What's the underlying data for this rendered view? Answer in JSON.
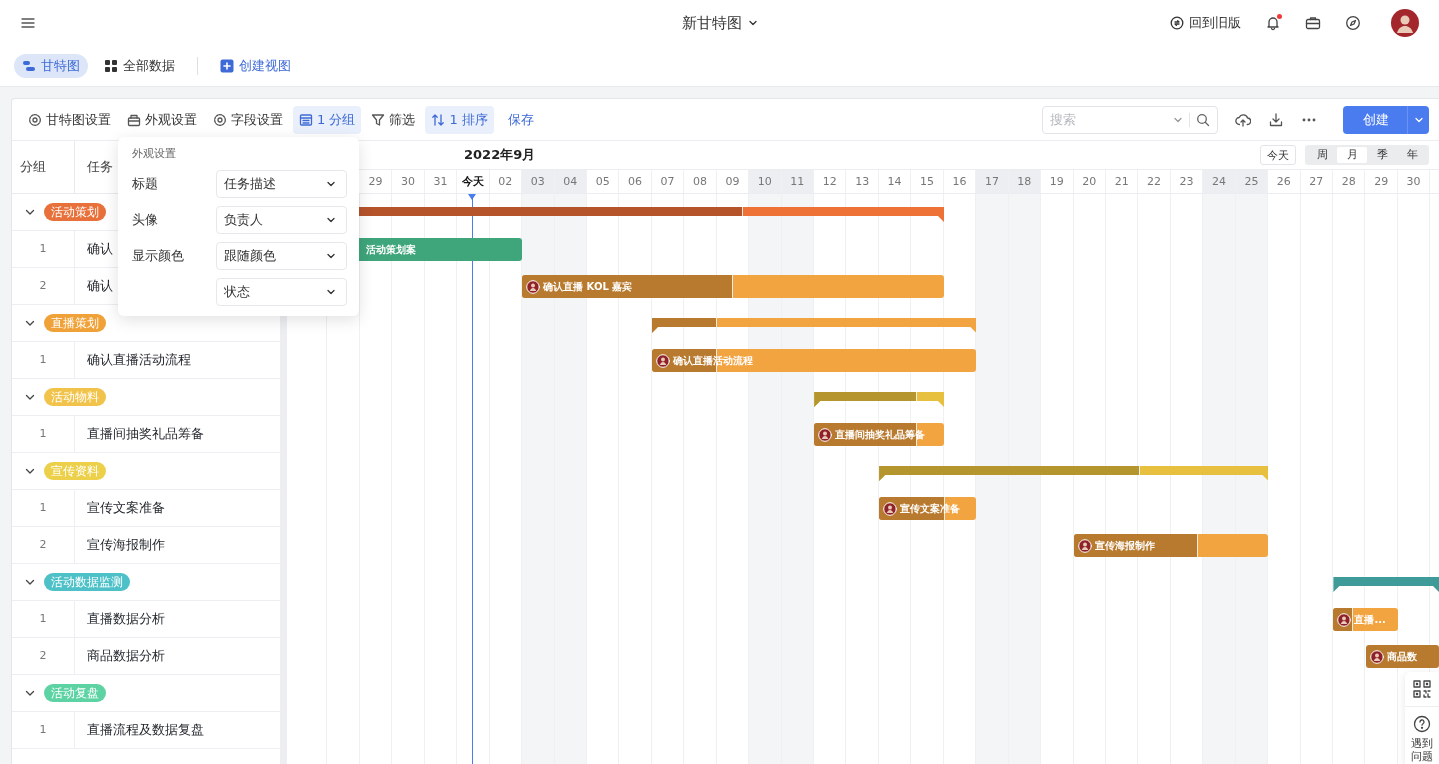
{
  "topbar": {
    "title": "新甘特图",
    "back_link": "回到旧版",
    "notification_dot": true
  },
  "view_tabs": [
    {
      "label": "甘特图",
      "selected": true,
      "kind": "gantt"
    },
    {
      "label": "全部数据",
      "selected": false,
      "kind": "grid"
    }
  ],
  "create_view": "创建视图",
  "toolbar": {
    "items": [
      {
        "label": "甘特图设置",
        "kind": "gear",
        "active": false
      },
      {
        "label": "外观设置",
        "kind": "palette",
        "active": false
      },
      {
        "label": "字段设置",
        "kind": "gear",
        "active": false
      },
      {
        "label": "1 分组",
        "kind": "group",
        "active": true
      },
      {
        "label": "筛选",
        "kind": "filter",
        "active": false
      },
      {
        "label": "1 排序",
        "kind": "sort",
        "active": true
      }
    ],
    "save": "保存",
    "search_placeholder": "搜索",
    "create": "创建"
  },
  "table": {
    "columns": [
      "分组",
      "任务"
    ]
  },
  "timeline": {
    "month": "2022年9月",
    "today_button": "今天",
    "scales": [
      {
        "label": "周",
        "selected": false
      },
      {
        "label": "月",
        "selected": true
      },
      {
        "label": "季",
        "selected": false
      },
      {
        "label": "年",
        "selected": false
      }
    ],
    "days": [
      {
        "label": "29",
        "weekend": false,
        "today": false
      },
      {
        "label": "30",
        "weekend": false,
        "today": false
      },
      {
        "label": "31",
        "weekend": false,
        "today": false
      },
      {
        "label": "今天",
        "weekend": false,
        "today": true
      },
      {
        "label": "02",
        "weekend": false,
        "today": false
      },
      {
        "label": "03",
        "weekend": true,
        "today": false
      },
      {
        "label": "04",
        "weekend": true,
        "today": false
      },
      {
        "label": "05",
        "weekend": false,
        "today": false
      },
      {
        "label": "06",
        "weekend": false,
        "today": false
      },
      {
        "label": "07",
        "weekend": false,
        "today": false
      },
      {
        "label": "08",
        "weekend": false,
        "today": false
      },
      {
        "label": "09",
        "weekend": false,
        "today": false
      },
      {
        "label": "10",
        "weekend": true,
        "today": false
      },
      {
        "label": "11",
        "weekend": true,
        "today": false
      },
      {
        "label": "12",
        "weekend": false,
        "today": false
      },
      {
        "label": "13",
        "weekend": false,
        "today": false
      },
      {
        "label": "14",
        "weekend": false,
        "today": false
      },
      {
        "label": "15",
        "weekend": false,
        "today": false
      },
      {
        "label": "16",
        "weekend": false,
        "today": false
      },
      {
        "label": "17",
        "weekend": true,
        "today": false
      },
      {
        "label": "18",
        "weekend": true,
        "today": false
      },
      {
        "label": "19",
        "weekend": false,
        "today": false
      },
      {
        "label": "20",
        "weekend": false,
        "today": false
      },
      {
        "label": "21",
        "weekend": false,
        "today": false
      },
      {
        "label": "22",
        "weekend": false,
        "today": false
      },
      {
        "label": "23",
        "weekend": false,
        "today": false
      },
      {
        "label": "24",
        "weekend": true,
        "today": false
      },
      {
        "label": "25",
        "weekend": true,
        "today": false
      },
      {
        "label": "26",
        "weekend": false,
        "today": false
      },
      {
        "label": "27",
        "weekend": false,
        "today": false
      },
      {
        "label": "28",
        "weekend": false,
        "today": false
      },
      {
        "label": "29",
        "weekend": false,
        "today": false
      },
      {
        "label": "30",
        "weekend": false,
        "today": false
      }
    ]
  },
  "groups": [
    {
      "label": "活动策划",
      "color": "#e8703a",
      "expanded": true,
      "bar": {
        "color": "#ee7236",
        "progress": {
          "level": 0.69,
          "color": "#b5532b"
        }
      },
      "tasks": [
        {
          "number": "1",
          "title": "确认",
          "bar": {
            "color": "#3fa57b",
            "label": "活动策划案",
            "avatar": false
          }
        },
        {
          "number": "2",
          "title": "确认",
          "bar": {
            "color": "#f2a440",
            "progress": {
              "level": 0.5,
              "color": "#b87a2e"
            },
            "label": "确认直播 KOL 嘉宾",
            "avatar": true
          }
        }
      ]
    },
    {
      "label": "直播策划",
      "color": "#f0a238",
      "expanded": true,
      "bar": {
        "color": "#f2a440",
        "progress": {
          "level": 0.2,
          "color": "#b87a2e"
        }
      },
      "tasks": [
        {
          "number": "1",
          "title": "确认直播活动流程",
          "bar": {
            "color": "#f2a440",
            "progress": {
              "level": 0.2,
              "color": "#b87a2e"
            },
            "label": "确认直播活动流程",
            "avatar": true
          }
        }
      ]
    },
    {
      "label": "活动物料",
      "color": "#f2c34a",
      "expanded": true,
      "bar": {
        "color": "#e8c040",
        "progress": {
          "level": 0.79,
          "color": "#b5962e"
        }
      },
      "tasks": [
        {
          "number": "1",
          "title": "直播间抽奖礼品筹备",
          "bar": {
            "color": "#f2a440",
            "progress": {
              "level": 0.79,
              "color": "#b87a2e"
            },
            "label": "直播间抽奖礼品筹备",
            "avatar": true
          }
        }
      ]
    },
    {
      "label": "宣传资料",
      "color": "#ecd04a",
      "expanded": true,
      "bar": {
        "color": "#e8c040",
        "progress": {
          "level": 0.67,
          "color": "#b5962e"
        }
      },
      "tasks": [
        {
          "number": "1",
          "title": "宣传文案准备",
          "bar": {
            "color": "#f2a440",
            "progress": {
              "level": 0.68,
              "color": "#b87a2e"
            },
            "label": "宣传文案准备",
            "avatar": true
          }
        },
        {
          "number": "2",
          "title": "宣传海报制作",
          "bar": {
            "color": "#f2a440",
            "progress": {
              "level": 0.64,
              "color": "#b87a2e"
            },
            "label": "宣传海报制作",
            "avatar": true
          }
        }
      ]
    },
    {
      "label": "活动数据监测",
      "color": "#4dc0c8",
      "expanded": true,
      "bar": {
        "color": "#3f9a9a"
      },
      "tasks": [
        {
          "number": "1",
          "title": "直播数据分析",
          "bar": {
            "color": "#f2a440",
            "progress": {
              "level": 0.3,
              "color": "#b87a2e"
            },
            "label": "直播...",
            "avatar": true
          }
        },
        {
          "number": "2",
          "title": "商品数据分析",
          "bar": {
            "color": "#b87a2e",
            "label": "商品数",
            "avatar": true
          }
        }
      ]
    },
    {
      "label": "活动复盘",
      "color": "#5dd3a3",
      "expanded": true,
      "tasks": [
        {
          "number": "1",
          "title": "直播流程及数据复盘"
        }
      ]
    }
  ],
  "popup": {
    "title": "外观设置",
    "rows": [
      {
        "label": "标题",
        "value": "任务描述"
      },
      {
        "label": "头像",
        "value": "负责人"
      },
      {
        "label": "显示颜色",
        "value": "跟随颜色"
      },
      {
        "value": "状态"
      }
    ]
  },
  "help": {
    "label": "遇到问题"
  }
}
